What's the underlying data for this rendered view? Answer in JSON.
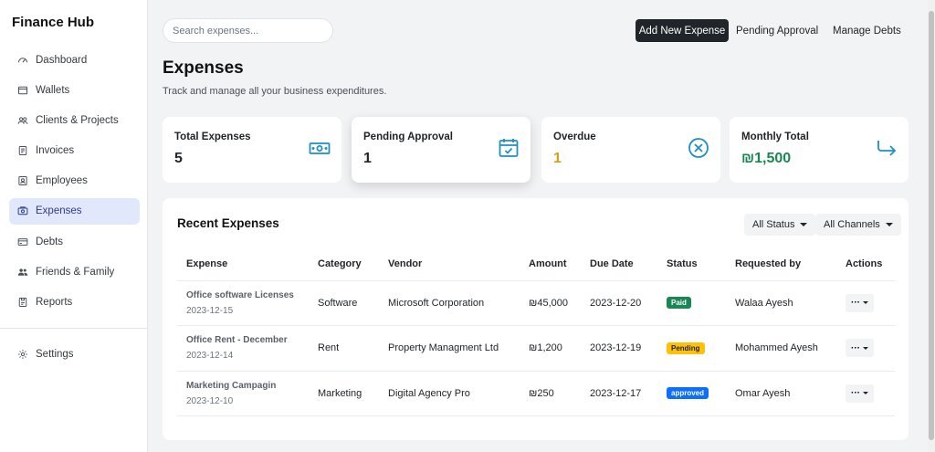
{
  "app": {
    "brand": "Finance Hub"
  },
  "sidebar": {
    "items": [
      {
        "label": "Dashboard",
        "icon": "dashboard-icon",
        "active": false
      },
      {
        "label": "Wallets",
        "icon": "wallet-icon",
        "active": false
      },
      {
        "label": "Clients & Projects",
        "icon": "people-icon",
        "active": false
      },
      {
        "label": "Invoices",
        "icon": "invoice-icon",
        "active": false
      },
      {
        "label": "Employees",
        "icon": "person-badge-icon",
        "active": false
      },
      {
        "label": "Expenses",
        "icon": "cash-icon",
        "active": true
      },
      {
        "label": "Debts",
        "icon": "credit-card-icon",
        "active": false
      },
      {
        "label": "Friends & Family",
        "icon": "group-icon",
        "active": false
      },
      {
        "label": "Reports",
        "icon": "report-icon",
        "active": false
      }
    ],
    "settings": {
      "label": "Settings",
      "icon": "gear-icon"
    }
  },
  "header": {
    "search_placeholder": "Search expenses...",
    "add_button": "Add New Expense",
    "pending_link": "Pending Approval",
    "debts_link": "Manage Debts"
  },
  "page": {
    "title": "Expenses",
    "subtitle": "Track and manage all your business expenditures."
  },
  "cards": [
    {
      "label": "Total Expenses",
      "value": "5",
      "value_color": "#212529",
      "icon": "cash-icon",
      "icon_color": "#1f8fc4"
    },
    {
      "label": "Pending Approval",
      "value": "1",
      "value_color": "#212529",
      "icon": "calendar-check-icon",
      "icon_color": "#1f8fc4"
    },
    {
      "label": "Overdue",
      "value": "1",
      "value_color": "#d4a017",
      "icon": "x-circle-icon",
      "icon_color": "#1f8fc4"
    },
    {
      "label": "Monthly Total",
      "value": "₪1,500",
      "value_color": "#198754",
      "icon": "arrow-return-icon",
      "icon_color": "#1f8fc4"
    }
  ],
  "recent": {
    "title": "Recent Expenses",
    "status_filter": "All Status",
    "channel_filter": "All Channels",
    "columns": [
      "Expense",
      "Category",
      "Vendor",
      "Amount",
      "Due Date",
      "Status",
      "Requested by",
      "Actions"
    ],
    "rows": [
      {
        "name": "Office software Licenses",
        "date": "2023-12-15",
        "category": "Software",
        "vendor": "Microsoft Corporation",
        "amount": "₪45,000",
        "due": "2023-12-20",
        "status": "Paid",
        "status_class": "paid",
        "requested_by": "Walaa Ayesh",
        "action_label": "···"
      },
      {
        "name": "Office Rent - December",
        "date": "2023-12-14",
        "category": "Rent",
        "vendor": "Property Managment Ltd",
        "amount": "₪1,200",
        "due": "2023-12-19",
        "status": "Pending",
        "status_class": "pending",
        "requested_by": "Mohammed Ayesh",
        "action_label": "···"
      },
      {
        "name": "Marketing Campagin",
        "date": "2023-12-10",
        "category": "Marketing",
        "vendor": "Digital Agency Pro",
        "amount": "₪250",
        "due": "2023-12-17",
        "status": "approved",
        "status_class": "approved",
        "requested_by": "Omar Ayesh",
        "action_label": "···"
      }
    ]
  }
}
